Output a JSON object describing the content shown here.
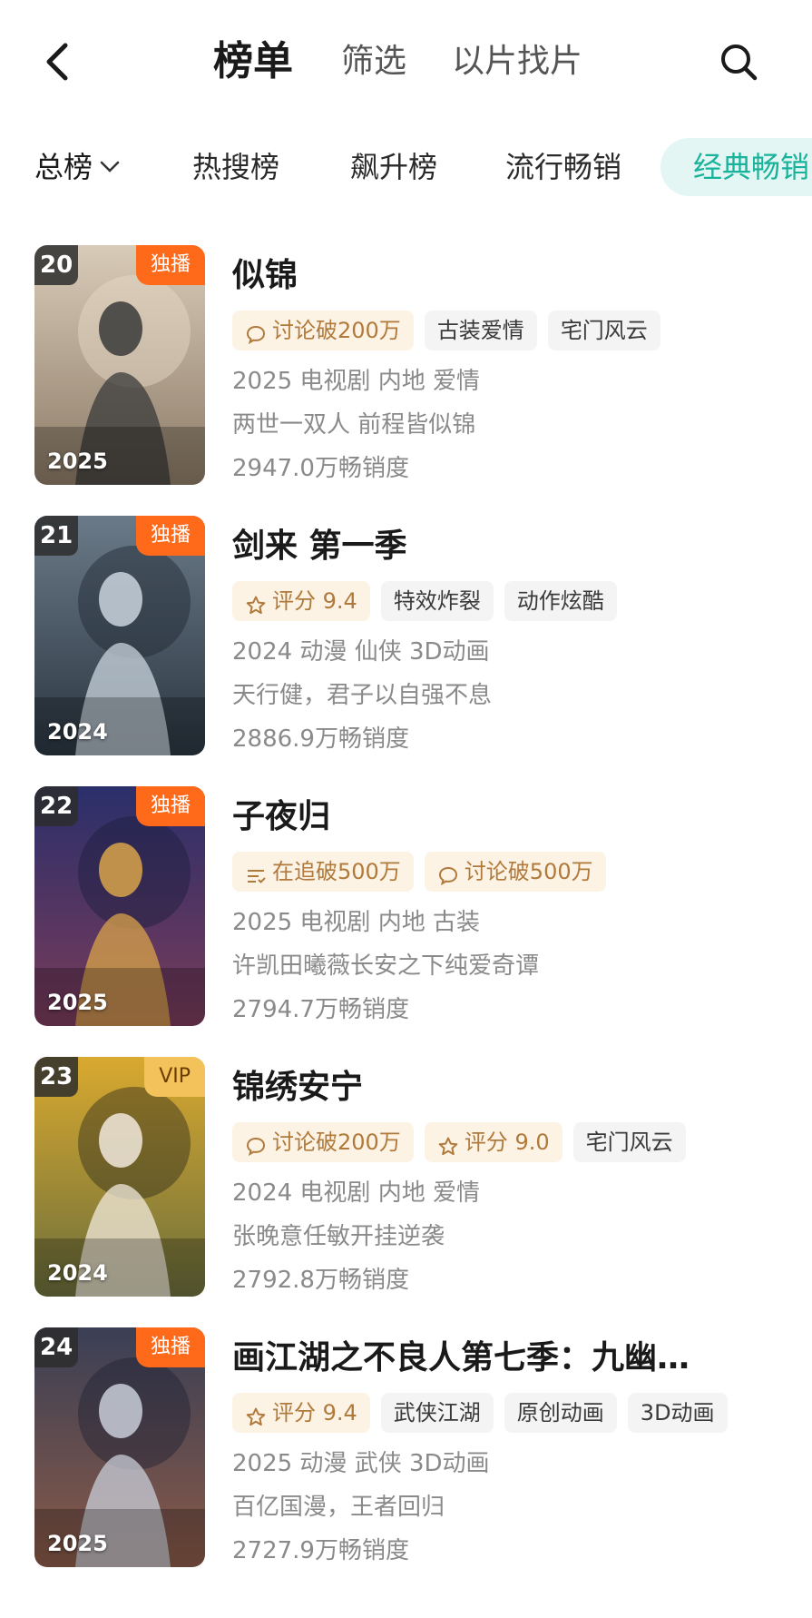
{
  "header": {
    "tabs": [
      "榜单",
      "筛选",
      "以片找片"
    ]
  },
  "categories": {
    "dropdown_label": "总榜",
    "items": [
      "热搜榜",
      "飙升榜",
      "流行畅销"
    ],
    "active_pill": "经典畅销"
  },
  "colors": {
    "accent_teal": "#19b29b",
    "exclusive_badge": "#ff6a1a",
    "vip_badge": "#f3c25b",
    "hot_tag_bg": "#fdf3e4"
  },
  "items": [
    {
      "rank": "20",
      "badge": "独播",
      "poster_year": "2025",
      "title": "似锦",
      "tags": [
        {
          "icon": "chat-bubble-icon",
          "text": "讨论破200万",
          "style": "hot"
        },
        {
          "text": "古装爱情",
          "style": "plain"
        },
        {
          "text": "宅门风云",
          "style": "plain"
        }
      ],
      "meta": "2025 电视剧 内地 爱情",
      "slogan": "两世一双人 前程皆似锦",
      "sales": "2947.0万畅销度"
    },
    {
      "rank": "21",
      "badge": "独播",
      "poster_year": "2024",
      "title": "剑来 第一季",
      "tags": [
        {
          "icon": "star-icon",
          "text": "评分 9.4",
          "style": "hot"
        },
        {
          "text": "特效炸裂",
          "style": "plain"
        },
        {
          "text": "动作炫酷",
          "style": "plain"
        }
      ],
      "meta": "2024 动漫 仙侠 3D动画",
      "slogan": "天行健，君子以自强不息",
      "sales": "2886.9万畅销度"
    },
    {
      "rank": "22",
      "badge": "独播",
      "poster_year": "2025",
      "title": "子夜归",
      "tags": [
        {
          "icon": "list-icon",
          "text": "在追破500万",
          "style": "hot"
        },
        {
          "icon": "chat-bubble-icon",
          "text": "讨论破500万",
          "style": "hot"
        }
      ],
      "meta": "2025 电视剧 内地 古装",
      "slogan": "许凯田曦薇长安之下纯爱奇谭",
      "sales": "2794.7万畅销度"
    },
    {
      "rank": "23",
      "badge": "VIP",
      "poster_year": "2024",
      "title": "锦绣安宁",
      "tags": [
        {
          "icon": "chat-bubble-icon",
          "text": "讨论破200万",
          "style": "hot"
        },
        {
          "icon": "star-icon",
          "text": "评分 9.0",
          "style": "hot"
        },
        {
          "text": "宅门风云",
          "style": "plain"
        }
      ],
      "meta": "2024 电视剧 内地 爱情",
      "slogan": "张晚意任敏开挂逆袭",
      "sales": "2792.8万畅销度"
    },
    {
      "rank": "24",
      "badge": "独播",
      "poster_year": "2025",
      "title": "画江湖之不良人第七季：九幽…",
      "tags": [
        {
          "icon": "star-icon",
          "text": "评分 9.4",
          "style": "hot"
        },
        {
          "text": "武侠江湖",
          "style": "plain"
        },
        {
          "text": "原创动画",
          "style": "plain"
        },
        {
          "text": "3D动画",
          "style": "plain"
        }
      ],
      "meta": "2025 动漫 武侠 3D动画",
      "slogan": "百亿国漫，王者回归",
      "sales": "2727.9万畅销度"
    }
  ]
}
